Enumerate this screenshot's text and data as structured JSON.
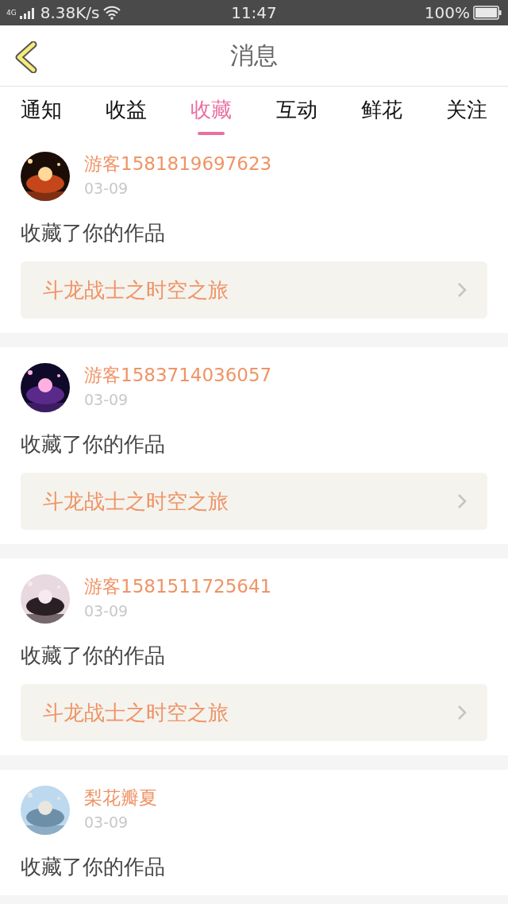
{
  "status_bar": {
    "network": "4G",
    "speed": "8.38K/s",
    "time": "11:47",
    "battery": "100%"
  },
  "header": {
    "title": "消息"
  },
  "tabs": [
    {
      "label": "通知",
      "selected": false
    },
    {
      "label": "收益",
      "selected": false
    },
    {
      "label": "收藏",
      "selected": true
    },
    {
      "label": "互动",
      "selected": false
    },
    {
      "label": "鲜花",
      "selected": false
    },
    {
      "label": "关注",
      "selected": false
    }
  ],
  "messages": [
    {
      "user": "游客1581819697623",
      "date": "03-09",
      "action": "收藏了你的作品",
      "work": "斗龙战士之时空之旅"
    },
    {
      "user": "游客1583714036057",
      "date": "03-09",
      "action": "收藏了你的作品",
      "work": "斗龙战士之时空之旅"
    },
    {
      "user": "游客1581511725641",
      "date": "03-09",
      "action": "收藏了你的作品",
      "work": "斗龙战士之时空之旅"
    },
    {
      "user": "梨花瓣夏",
      "date": "03-09",
      "action": "收藏了你的作品"
    }
  ]
}
